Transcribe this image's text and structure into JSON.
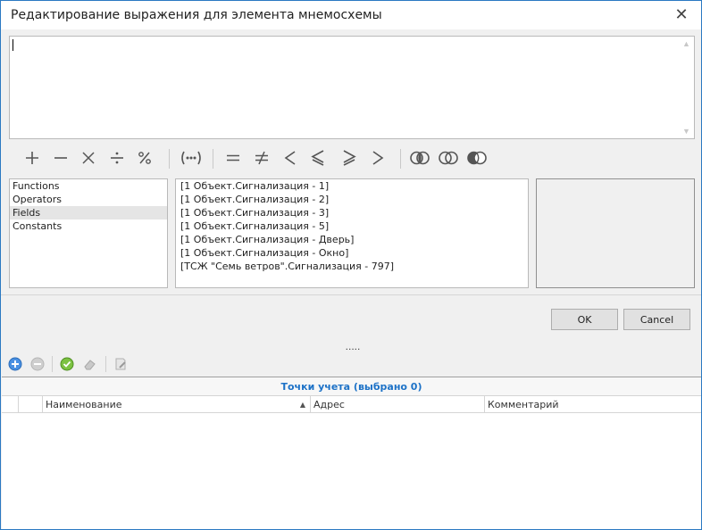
{
  "window": {
    "title": "Редактирование выражения для элемента мнемосхемы"
  },
  "expression": {
    "value": ""
  },
  "operators": [
    {
      "name": "plus-icon",
      "symbol": "+"
    },
    {
      "name": "minus-icon",
      "symbol": "−"
    },
    {
      "name": "multiply-icon",
      "symbol": "×"
    },
    {
      "name": "divide-icon",
      "symbol": "÷"
    },
    {
      "name": "percent-icon",
      "symbol": "%"
    },
    {
      "name": "parentheses-icon",
      "symbol": "(•••)"
    },
    {
      "name": "equal-icon",
      "symbol": "="
    },
    {
      "name": "not-equal-icon",
      "symbol": "≠"
    },
    {
      "name": "less-icon",
      "symbol": "<"
    },
    {
      "name": "less-equal-icon",
      "symbol": "≤"
    },
    {
      "name": "greater-equal-icon",
      "symbol": "≥"
    },
    {
      "name": "greater-icon",
      "symbol": ">"
    },
    {
      "name": "and-icon",
      "symbol": "∩"
    },
    {
      "name": "or-icon",
      "symbol": "∪"
    },
    {
      "name": "not-icon",
      "symbol": "¬"
    }
  ],
  "categories": {
    "items": [
      "Functions",
      "Operators",
      "Fields",
      "Constants"
    ],
    "selected": "Fields"
  },
  "fields": {
    "items": [
      "[1 Объект.Сигнализация - 1]",
      "[1 Объект.Сигнализация - 2]",
      "[1 Объект.Сигнализация - 3]",
      "[1 Объект.Сигнализация - 5]",
      "[1 Объект.Сигнализация - Дверь]",
      "[1 Объект.Сигнализация - Окно]",
      "[ТСЖ \"Семь ветров\".Сигнализация - 797]"
    ]
  },
  "buttons": {
    "ok": "OK",
    "cancel": "Cancel"
  },
  "splitter": ".....",
  "grid": {
    "caption": "Точки учета (выбрано 0)",
    "columns": [
      "Наименование",
      "Адрес",
      "Комментарий"
    ]
  }
}
